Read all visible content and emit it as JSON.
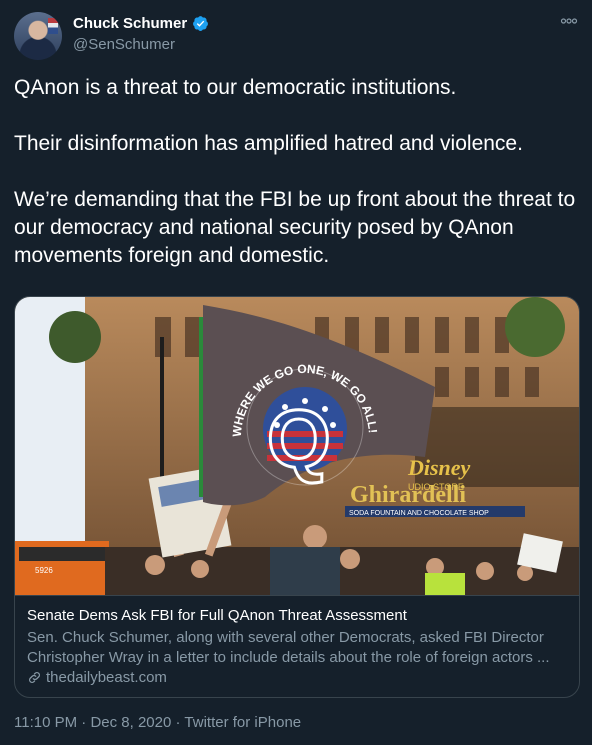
{
  "tweet": {
    "author_name": "Chuck Schumer",
    "author_handle": "@SenSchumer",
    "paragraphs": [
      "QAnon is a threat to our democratic institutions.",
      "Their disinformation has amplified hatred and violence.",
      "We’re demanding that the FBI be up front about the threat to our democracy and national security posed by QAnon movements foreign and domestic."
    ],
    "time": "11:10 PM",
    "date": "Dec 8, 2020",
    "source": "Twitter for iPhone"
  },
  "card": {
    "title": "Senate Dems Ask FBI for Full QAnon Threat Assessment",
    "description_line1": "Sen. Chuck Schumer, along with several other Democrats, asked FBI Director",
    "description_line2": "Christopher Wray in a letter to include details about the role of foreign actors ...",
    "domain": "thedailybeast.com",
    "image_text": {
      "flag_arc": "WHERE WE GO ONE, WE GO ALL!",
      "flag_letter": "Q",
      "store_sign_1": "Disney",
      "store_sign_2": "UDIO STORE",
      "store_sign_3": "Ghirardelli",
      "store_sign_4": "SODA FOUNTAIN AND CHOCOLATE SHOP",
      "bus_number": "5926"
    }
  },
  "colors": {
    "background": "#15202b",
    "secondary_text": "#8899a6",
    "verified_blue": "#1da1f2",
    "border": "#38444d"
  },
  "icons": [
    "verified-icon",
    "more-icon",
    "link-icon"
  ]
}
